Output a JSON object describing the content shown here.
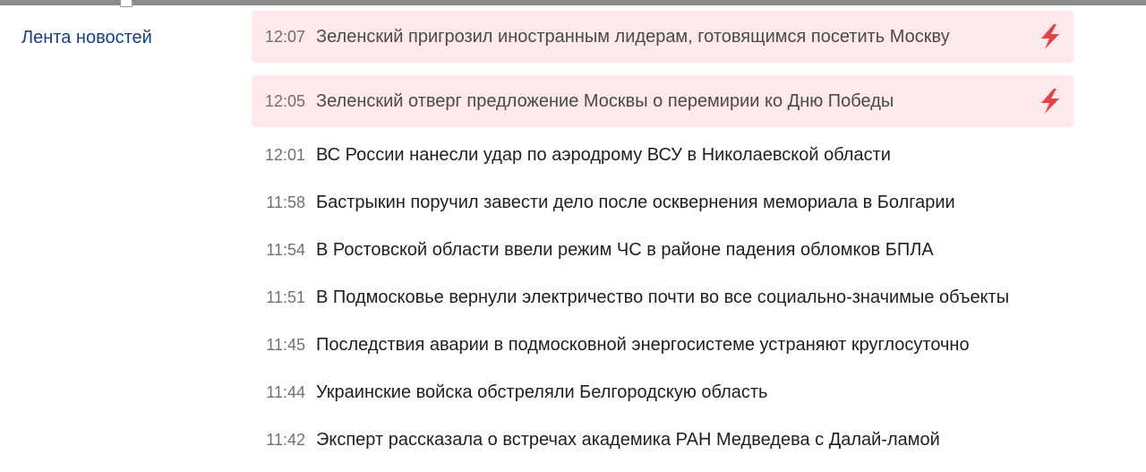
{
  "sidebar": {
    "title": "Лента новостей"
  },
  "accent_color": "#e8404a",
  "urgent_background": "#fde9ea",
  "news": [
    {
      "time": "12:07",
      "title": "Зеленский пригрозил иностранным лидерам, готовящимся посетить Москву",
      "urgent": true
    },
    {
      "time": "12:05",
      "title": "Зеленский отверг предложение Москвы о перемирии ко Дню Победы",
      "urgent": true
    },
    {
      "time": "12:01",
      "title": "ВС России нанесли удар по аэродрому ВСУ в Николаевской области",
      "urgent": false
    },
    {
      "time": "11:58",
      "title": "Бастрыкин поручил завести дело после осквернения мемориала в Болгарии",
      "urgent": false
    },
    {
      "time": "11:54",
      "title": "В Ростовской области ввели режим ЧС в районе падения обломков БПЛА",
      "urgent": false
    },
    {
      "time": "11:51",
      "title": "В Подмосковье вернули электричество почти во все социально-значимые объекты",
      "urgent": false
    },
    {
      "time": "11:45",
      "title": "Последствия аварии в подмосковной энергосистеме устраняют круглосуточно",
      "urgent": false
    },
    {
      "time": "11:44",
      "title": "Украинские войска обстреляли Белгородскую область",
      "urgent": false
    },
    {
      "time": "11:42",
      "title": "Эксперт рассказала о встречах академика РАН Медведева с Далай-ламой",
      "urgent": false
    }
  ]
}
